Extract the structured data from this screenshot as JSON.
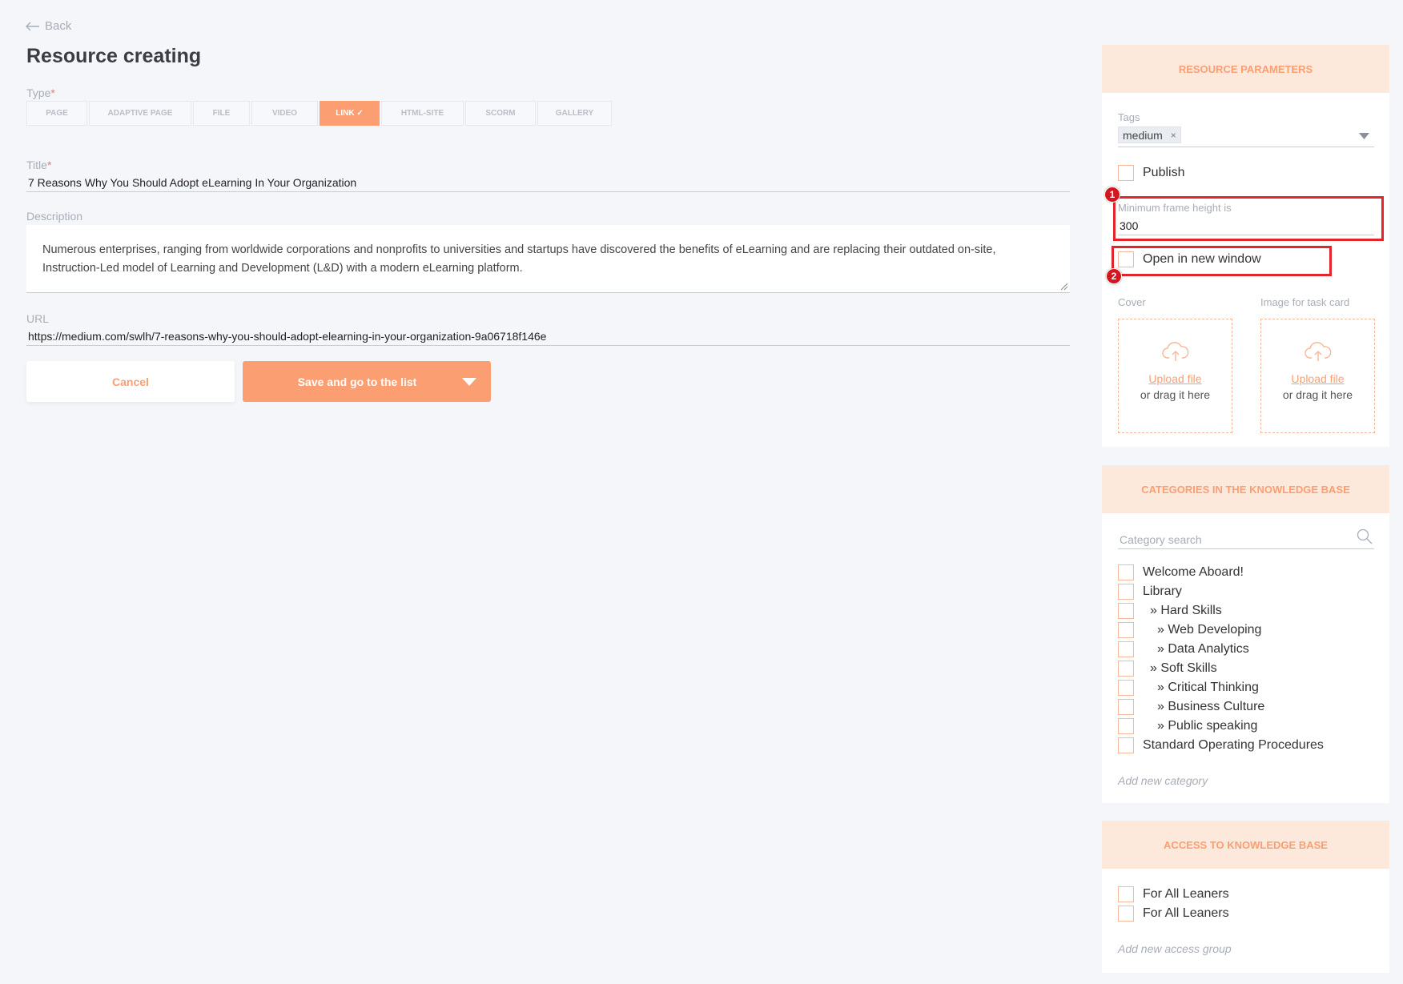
{
  "nav": {
    "back_label": "Back"
  },
  "page": {
    "title": "Resource creating"
  },
  "form": {
    "type_label": "Type",
    "type_tabs": [
      {
        "label": "PAGE"
      },
      {
        "label": "ADAPTIVE PAGE"
      },
      {
        "label": "FILE"
      },
      {
        "label": "VIDEO"
      },
      {
        "label": "LINK ✓",
        "active": true
      },
      {
        "label": "HTML-SITE"
      },
      {
        "label": "SCORM"
      },
      {
        "label": "GALLERY"
      }
    ],
    "title_label": "Title",
    "title_value": "7 Reasons Why You Should Adopt eLearning In Your Organization",
    "description_label": "Description",
    "description_value": "Numerous enterprises, ranging from worldwide corporations and nonprofits to universities and startups have discovered the benefits of eLearning and are replacing their outdated on-site, Instruction-Led model of Learning and Development (L&D) with a modern eLearning platform.",
    "url_label": "URL",
    "url_value": "https://medium.com/swlh/7-reasons-why-you-should-adopt-elearning-in-your-organization-9a06718f146e",
    "required_mark": "*"
  },
  "actions": {
    "cancel_label": "Cancel",
    "save_label": "Save and go to the list"
  },
  "resource_params": {
    "heading": "RESOURCE PARAMETERS",
    "tags_label": "Tags",
    "tags": [
      "medium"
    ],
    "tag_remove": "×",
    "publish_label": "Publish",
    "frame_height_label": "Minimum frame height is",
    "frame_height_value": "300",
    "open_new_window_label": "Open in new window",
    "cover_label": "Cover",
    "task_card_label": "Image for task card",
    "upload_link": "Upload file",
    "upload_sub": "or drag it here",
    "annotation_1": "1",
    "annotation_2": "2"
  },
  "categories": {
    "heading": "CATEGORIES IN THE KNOWLEDGE BASE",
    "search_placeholder": "Category search",
    "items": [
      "Welcome Aboard!",
      "Library",
      "» Hard Skills",
      "» Web Developing",
      "» Data Analytics",
      "» Soft Skills",
      "» Critical Thinking",
      "» Business Culture",
      "» Public speaking",
      "Standard Operating Procedures"
    ],
    "add_label": "Add new category"
  },
  "access": {
    "heading": "ACCESS TO KNOWLEDGE BASE",
    "items": [
      "For All Leaners",
      "For All Leaners"
    ],
    "add_label": "Add new access group"
  },
  "colors": {
    "accent": "#fb9f72",
    "accent_light": "#fde8dc",
    "highlight": "#e2242b",
    "background": "#f5f6fa"
  },
  "icons": [
    "arrow-left-icon",
    "check-icon",
    "chevron-down-icon",
    "cloud-upload-icon",
    "search-icon",
    "resize-handle-icon"
  ]
}
